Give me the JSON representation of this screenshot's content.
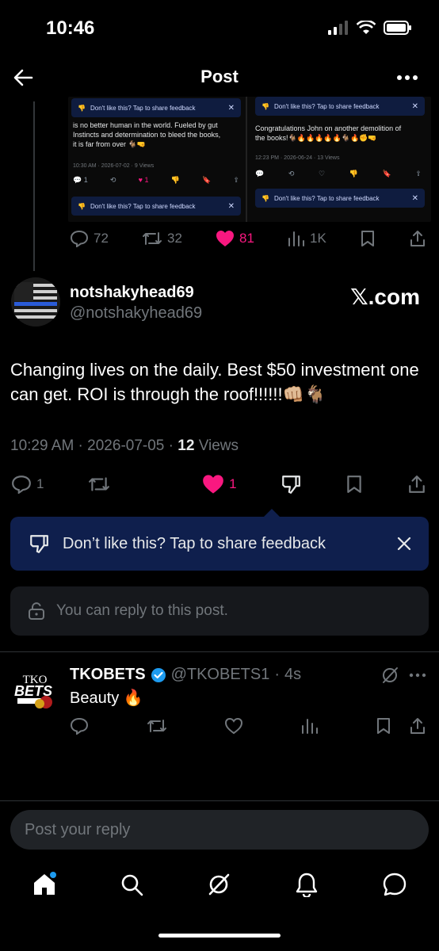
{
  "status_bar": {
    "time": "10:46"
  },
  "header": {
    "title": "Post"
  },
  "embedded": {
    "left": {
      "feedback_top": "Don't like this? Tap to share feedback",
      "text_lines": [
        "is no better human in the world. Fueled by gut",
        "Instincts and determination to bleed the books,",
        "it is far from over 🐐🤜"
      ],
      "meta": "10:30 AM · 2026-07-02 · 9 Views",
      "reply_count": "1",
      "like_count": "1",
      "feedback_bottom": "Don't like this? Tap to share feedback"
    },
    "right": {
      "feedback_top": "Don't like this? Tap to share feedback",
      "text_lines": [
        "Congratulations John on another demolition of",
        "the books!🐐🔥🔥🔥🔥🔥🐐🔥✊🤜"
      ],
      "meta": "12:23 PM · 2026-06-24 · 13 Views",
      "feedback_bottom": "Don't like this? Tap to share feedback"
    }
  },
  "parent_actions": {
    "replies": "72",
    "reposts": "32",
    "likes": "81",
    "views": "1K"
  },
  "post": {
    "display_name": "notshakyhead69",
    "handle": "@notshakyhead69",
    "watermark": "𝕏.com",
    "text": "Changing lives on the daily. Best $50 investment one can get. ROI is through the roof!!!!!!👊🏼🐐",
    "time": "10:29 AM",
    "date": "2026-07-05",
    "views_count": "12",
    "views_label": "Views",
    "replies": "1",
    "likes": "1"
  },
  "feedback_banner": {
    "text": "Don’t like this? Tap to share feedback"
  },
  "reply_notice": {
    "text": "You can reply to this post."
  },
  "reply": {
    "display_name": "TKOBETS",
    "handle": "@TKOBETS1",
    "time": "4s",
    "text": "Beauty 🔥",
    "avatar_text_top": "TKO",
    "avatar_text_main": "BETS"
  },
  "composer": {
    "placeholder": "Post your reply"
  },
  "colors": {
    "like_pink": "#f91880",
    "feedback_bg": "#0f1f4d",
    "verified_blue": "#1d9bf0"
  }
}
